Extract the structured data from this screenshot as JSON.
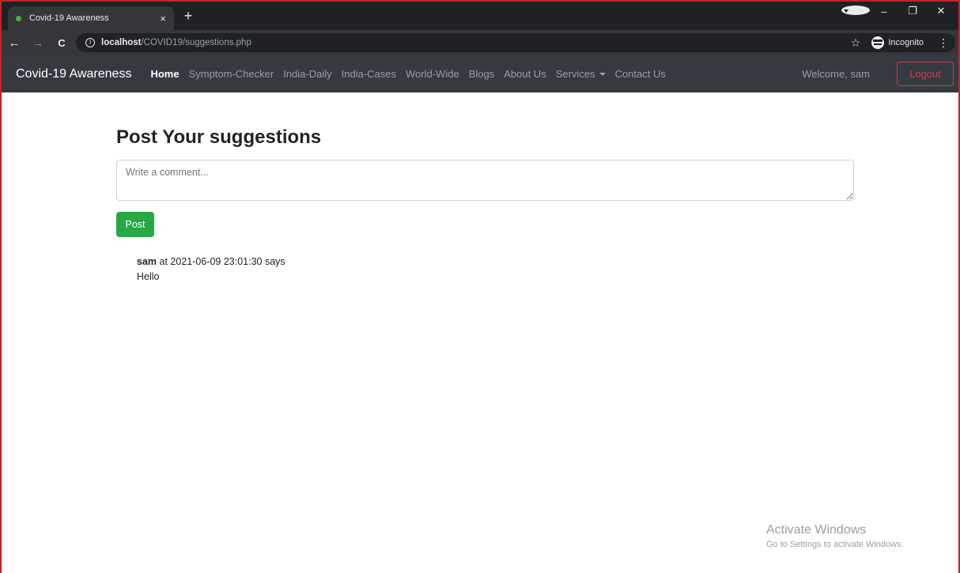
{
  "browser": {
    "tab_title": "Covid-19 Awareness",
    "tab_close": "×",
    "new_tab": "+",
    "url_host": "localhost",
    "url_path": "/COVID19/suggestions.php",
    "incognito_label": "Incognito",
    "back_icon": "←",
    "forward_icon": "→",
    "reload_icon": "C",
    "star_icon": "☆",
    "kebab_icon": "⋮",
    "minimize_icon": "–",
    "restore_icon": "❐",
    "close_icon": "✕"
  },
  "navbar": {
    "brand": "Covid-19 Awareness",
    "links": [
      "Home",
      "Symptom-Checker",
      "India-Daily",
      "India-Cases",
      "World-Wide",
      "Blogs",
      "About Us",
      "Services",
      "Contact Us"
    ],
    "welcome": "Welcome, sam",
    "logout": "Logout"
  },
  "main": {
    "title": "Post Your suggestions",
    "comment_placeholder": "Write a comment...",
    "post_button": "Post",
    "comments": [
      {
        "author": "sam",
        "meta": " at 2021-06-09 23:01:30 says",
        "text": "Hello"
      }
    ]
  },
  "watermark": {
    "title": "Activate Windows",
    "subtitle": "Go to Settings to activate Windows."
  },
  "colors": {
    "navbar_bg": "#343a40",
    "post_green": "#28a745",
    "logout_red": "#dc3545"
  }
}
